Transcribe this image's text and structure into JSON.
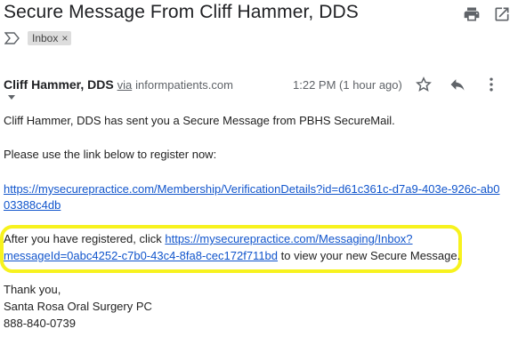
{
  "email": {
    "subject": "Secure Message From Cliff Hammer, DDS",
    "label_chip": "Inbox",
    "label_remove": "×",
    "sender_name": "Cliff Hammer, DDS",
    "via_word": "via",
    "sender_domain": "informpatients.com",
    "time": "1:22 PM (1 hour ago)"
  },
  "body": {
    "line1": "Cliff Hammer, DDS has sent you a Secure Message from PBHS SecureMail.",
    "line2": "Please use the link below to register now:",
    "reg_link_part1": "https://mysecurepractice.com/Membership/VerificationDetails?id=d61c361c-d7a9-403e-926c-ab0",
    "reg_link_part2": "03388c4db",
    "after_prefix": "After you have registered, click ",
    "inbox_link_part1": "https://mysecurepractice.com/Messaging/Inbox?",
    "inbox_link_part2": "messageId=0abc4252-c7b0-43c4-8fa8-cec172f711bd",
    "after_suffix": " to view your new Secure Message.",
    "thanks": "Thank you,",
    "practice": "Santa Rosa Oral Surgery PC",
    "phone": "888-840-0739"
  },
  "icons": {
    "print": "print-icon",
    "open_new": "open-in-new-window-icon",
    "important": "importance-marker-icon",
    "star": "star-icon",
    "reply": "reply-icon",
    "more": "more-vert-icon"
  },
  "colors": {
    "link": "#1155cc",
    "highlight": "#f7f21e"
  }
}
